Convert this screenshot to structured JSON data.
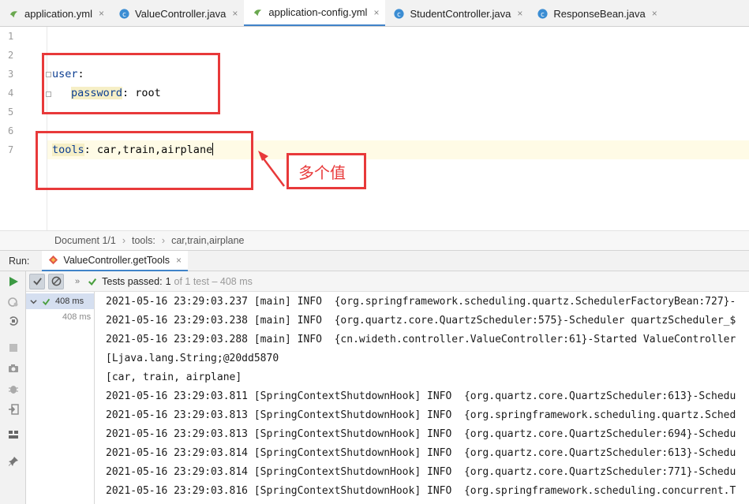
{
  "tabs": [
    {
      "label": "application.yml",
      "icon": "yaml-icon",
      "active": false
    },
    {
      "label": "ValueController.java",
      "icon": "java-class-icon",
      "active": false
    },
    {
      "label": "application-config.yml",
      "icon": "yaml-icon",
      "active": true
    },
    {
      "label": "StudentController.java",
      "icon": "java-class-icon",
      "active": false
    },
    {
      "label": "ResponseBean.java",
      "icon": "java-class-icon",
      "active": false
    }
  ],
  "close_glyph": "×",
  "editor": {
    "line_numbers": [
      "1",
      "2",
      "3",
      "4",
      "5",
      "6",
      "7"
    ],
    "line3_key": "user",
    "line3_colon": ":",
    "line4_key": "password",
    "line4_rest": ": root",
    "line7_key": "tools",
    "line7_rest": ": car,train,airplane"
  },
  "annotation": {
    "text": "多个值",
    "color": "#e8393a"
  },
  "breadcrumb": [
    "Document 1/1",
    "tools:",
    "car,train,airplane"
  ],
  "breadcrumb_sep": "›",
  "run": {
    "label": "Run:",
    "tab_label": "ValueController.getTools"
  },
  "testbar": {
    "chevron": "»",
    "passed_label": "Tests passed:",
    "passed_value": "1",
    "passed_total": "of 1 test – 408 ms"
  },
  "testtree": {
    "root_time": "408 ms",
    "child_time": "408 ms"
  },
  "console_lines": [
    "2021-05-16 23:29:03.237 [main] INFO  {org.springframework.scheduling.quartz.SchedulerFactoryBean:727}-",
    "2021-05-16 23:29:03.238 [main] INFO  {org.quartz.core.QuartzScheduler:575}-Scheduler quartzScheduler_$",
    "2021-05-16 23:29:03.288 [main] INFO  {cn.wideth.controller.ValueController:61}-Started ValueController",
    "[Ljava.lang.String;@20dd5870",
    "[car, train, airplane]",
    "2021-05-16 23:29:03.811 [SpringContextShutdownHook] INFO  {org.quartz.core.QuartzScheduler:613}-Schedu",
    "2021-05-16 23:29:03.813 [SpringContextShutdownHook] INFO  {org.springframework.scheduling.quartz.Sched",
    "2021-05-16 23:29:03.813 [SpringContextShutdownHook] INFO  {org.quartz.core.QuartzScheduler:694}-Schedu",
    "2021-05-16 23:29:03.814 [SpringContextShutdownHook] INFO  {org.quartz.core.QuartzScheduler:613}-Schedu",
    "2021-05-16 23:29:03.814 [SpringContextShutdownHook] INFO  {org.quartz.core.QuartzScheduler:771}-Schedu",
    "2021-05-16 23:29:03.816 [SpringContextShutdownHook] INFO  {org.springframework.scheduling.concurrent.T"
  ],
  "colors": {
    "accent": "#4083c9",
    "pass_green": "#4a9f3f",
    "yaml_key": "#0b3d91",
    "highlight_box": "#e8393a"
  }
}
